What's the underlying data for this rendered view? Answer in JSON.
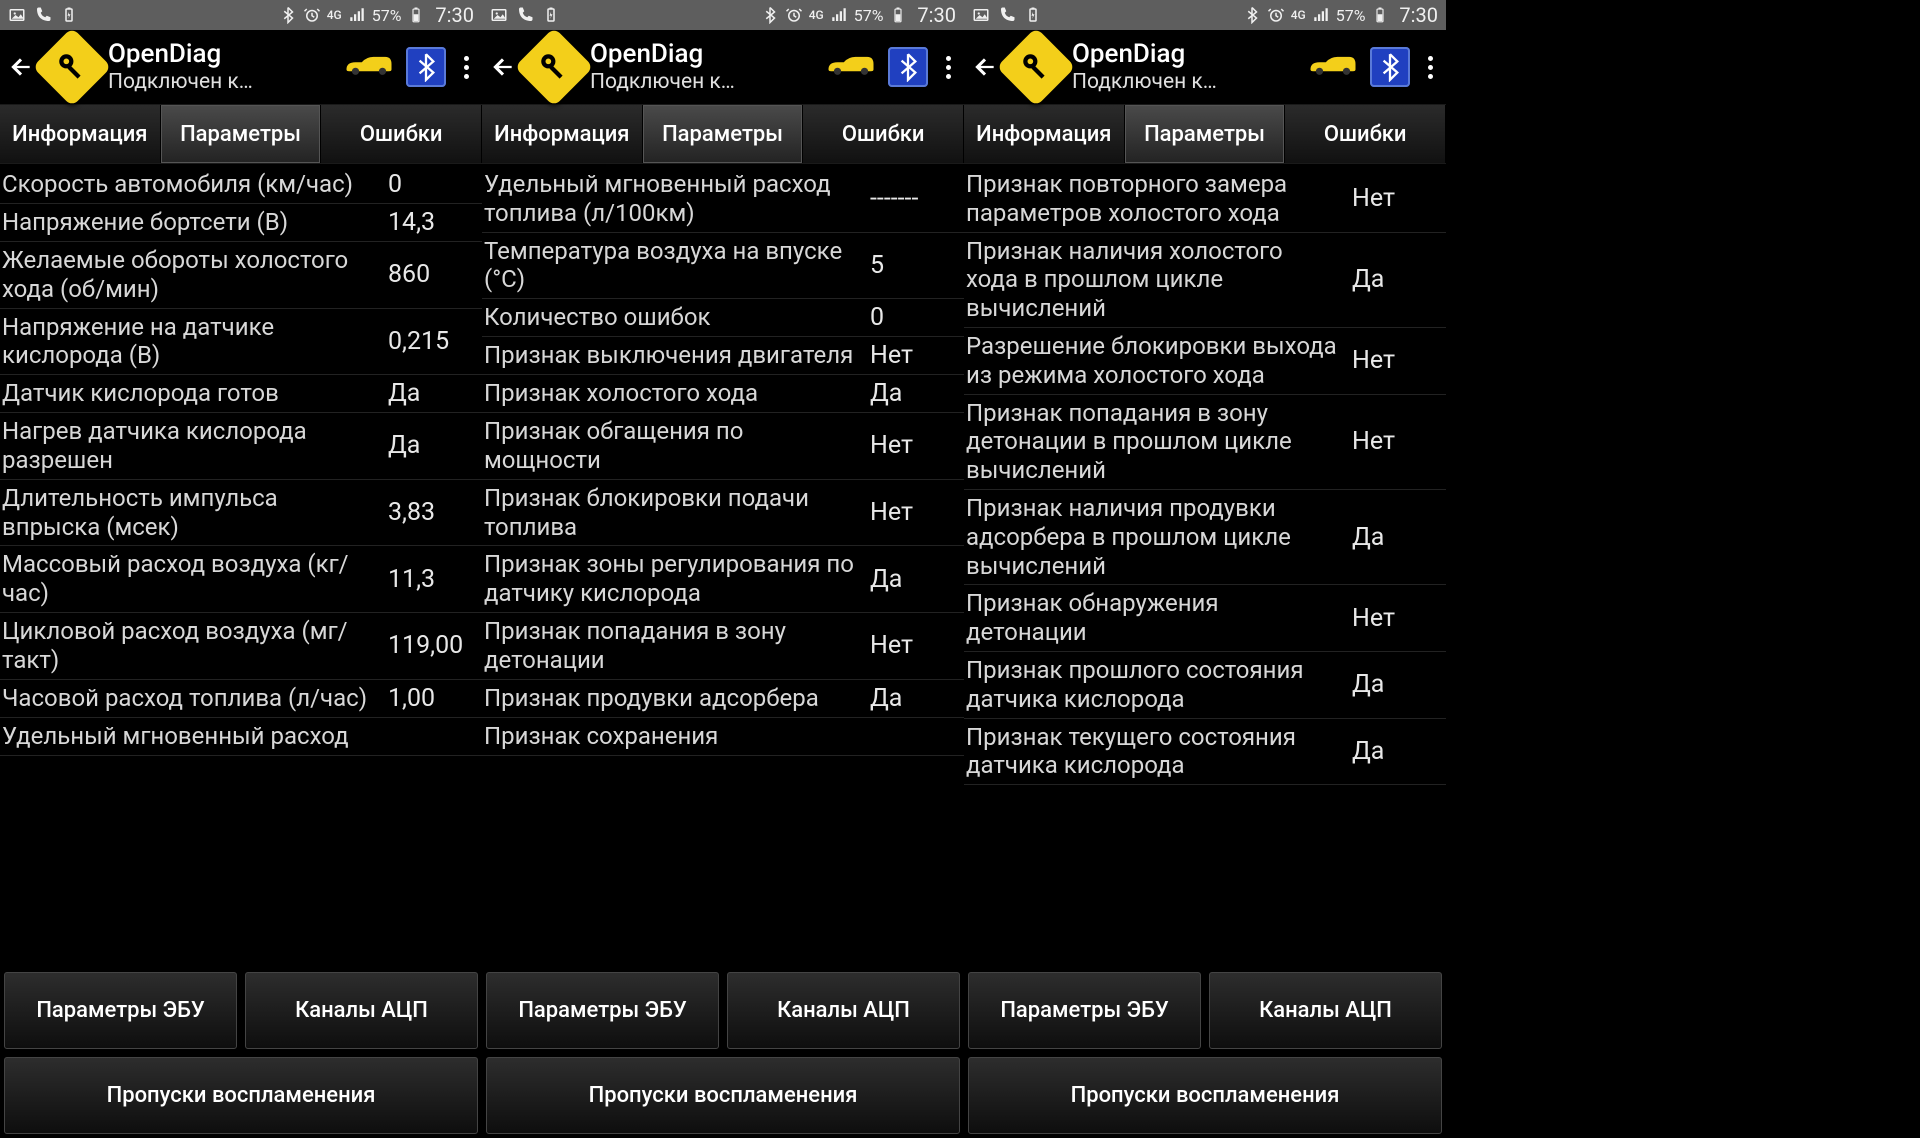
{
  "status": {
    "network": "4G",
    "battery": "57%",
    "time": "7:30"
  },
  "app": {
    "title": "OpenDiag",
    "subtitle": "Подключен к…"
  },
  "tabs": {
    "info": "Информация",
    "params": "Параметры",
    "errors": "Ошибки"
  },
  "bottom": {
    "ecu": "Параметры ЭБУ",
    "adc": "Каналы АЦП",
    "misfire": "Пропуски воспламенения"
  },
  "panels": [
    {
      "rows": [
        {
          "label": "Скорость автомобиля (км/час)",
          "value": "0"
        },
        {
          "label": "Напряжение бортсети (В)",
          "value": "14,3"
        },
        {
          "label": "Желаемые обороты холостого хода (об/мин)",
          "value": "860"
        },
        {
          "label": "Напряжение на датчике кислорода (В)",
          "value": "0,215"
        },
        {
          "label": "Датчик кислорода готов",
          "value": "Да"
        },
        {
          "label": "Нагрев датчика кислорода разрешен",
          "value": "Да"
        },
        {
          "label": "Длительность импульса впрыска (мсек)",
          "value": "3,83"
        },
        {
          "label": "Массовый расход воздуха (кг/час)",
          "value": "11,3"
        },
        {
          "label": "Цикловой расход воздуха (мг/такт)",
          "value": "119,00"
        },
        {
          "label": "Часовой расход топлива (л/час)",
          "value": "1,00"
        },
        {
          "label": "Удельный мгновенный расход",
          "value": ""
        }
      ]
    },
    {
      "rows": [
        {
          "label": "Удельный мгновенный расход топлива (л/100км)",
          "value": "-------"
        },
        {
          "label": "Температура воздуха на впуске (°C)",
          "value": "5"
        },
        {
          "label": "Количество ошибок",
          "value": "0"
        },
        {
          "label": "Признак выключения двигателя",
          "value": "Нет"
        },
        {
          "label": "Признак холостого хода",
          "value": "Да"
        },
        {
          "label": "Признак обгащения по мощности",
          "value": "Нет"
        },
        {
          "label": "Признак блокировки подачи топлива",
          "value": "Нет"
        },
        {
          "label": "Признак зоны регулирования по датчику кислорода",
          "value": "Да"
        },
        {
          "label": "Признак попадания в зону детонации",
          "value": "Нет"
        },
        {
          "label": "Признак продувки адсорбера",
          "value": "Да"
        },
        {
          "label": "Признак сохранения",
          "value": ""
        }
      ]
    },
    {
      "rows": [
        {
          "label": "Признак повторного замера параметров холостого хода",
          "value": "Нет"
        },
        {
          "label": "Признак наличия холостого хода в прошлом цикле вычислений",
          "value": "Да"
        },
        {
          "label": "Разрешение блокировки выхода из режима холостого хода",
          "value": "Нет"
        },
        {
          "label": "Признак попадания в зону детонации в прошлом цикле вычислений",
          "value": "Нет"
        },
        {
          "label": "Признак наличия продувки адсорбера в прошлом цикле вычислений",
          "value": "Да"
        },
        {
          "label": "Признак обнаружения детонации",
          "value": "Нет"
        },
        {
          "label": "Признак прошлого состояния датчика кислорода",
          "value": "Да"
        },
        {
          "label": "Признак текущего состояния датчика кислорода",
          "value": "Да"
        }
      ]
    }
  ]
}
